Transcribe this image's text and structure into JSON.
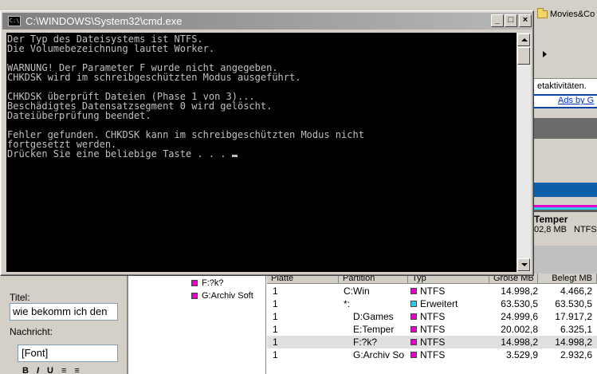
{
  "cmd": {
    "title": "C:\\WINDOWS\\System32\\cmd.exe",
    "icon_label": "C:\\",
    "lines": [
      "Der Typ des Dateisystems ist NTFS.",
      "Die Volumebezeichnung lautet Worker.",
      "",
      "WARNUNG! Der Parameter F wurde nicht angegeben.",
      "CHKDSK wird im schreibgeschützten Modus ausgeführt.",
      "",
      "CHKDSK überprüft Dateien (Phase 1 von 3)...",
      "Beschädigtes Datensatzsegment 0 wird gelöscht.",
      "Dateiüberprüfung beendet.",
      "",
      "Fehler gefunden. CHKDSK kann im schreibgeschützten Modus nicht",
      "fortgesetzt werden.",
      "Drücken Sie eine beliebige Taste . . . "
    ],
    "buttons": {
      "minimize": "_",
      "maximize": "□",
      "close": "×"
    }
  },
  "background": {
    "folder_label": "Movies&Co",
    "activity_text": "etaktivitäten.",
    "ads_link": "Ads by G",
    "temper_label": "Temper",
    "temper_size": "02,8 MB",
    "temper_fs": "NTFS"
  },
  "message_form": {
    "title_label": "Titel:",
    "title_value": "wie bekomm ich den",
    "body_label": "Nachricht:",
    "font_value": "[Font]",
    "format_buttons": [
      "B",
      "I",
      "U",
      "≡",
      "≡"
    ]
  },
  "tree": [
    {
      "label": "F:?k?",
      "color": "#e000d0"
    },
    {
      "label": "G:Archiv Soft",
      "color": "#e000d0"
    }
  ],
  "partition_table": {
    "headers": [
      "Platte",
      "Partition",
      "Typ",
      "Größe MB",
      "Belegt MB"
    ],
    "rows": [
      {
        "disk": "1",
        "partition": "C:Win",
        "type": "NTFS",
        "type_color": "#e000d0",
        "size": "14.998,2",
        "used": "4.466,2"
      },
      {
        "disk": "1",
        "partition": "*:",
        "type": "Erweitert",
        "type_color": "#2fc9e6",
        "size": "63.530,5",
        "used": "63.530,5"
      },
      {
        "disk": "1",
        "partition": "D:Games",
        "type": "NTFS",
        "type_color": "#e000d0",
        "size": "24.999,6",
        "used": "17.917,2"
      },
      {
        "disk": "1",
        "partition": "E:Temper",
        "type": "NTFS",
        "type_color": "#e000d0",
        "size": "20.002,8",
        "used": "6.325,1"
      },
      {
        "disk": "1",
        "partition": "F:?k?",
        "type": "NTFS",
        "type_color": "#e000d0",
        "size": "14.998,2",
        "used": "14.998,2",
        "selected": true
      },
      {
        "disk": "1",
        "partition": "G:Archiv So",
        "type": "NTFS",
        "type_color": "#e000d0",
        "size": "3.529,9",
        "used": "2.932,6"
      }
    ]
  }
}
